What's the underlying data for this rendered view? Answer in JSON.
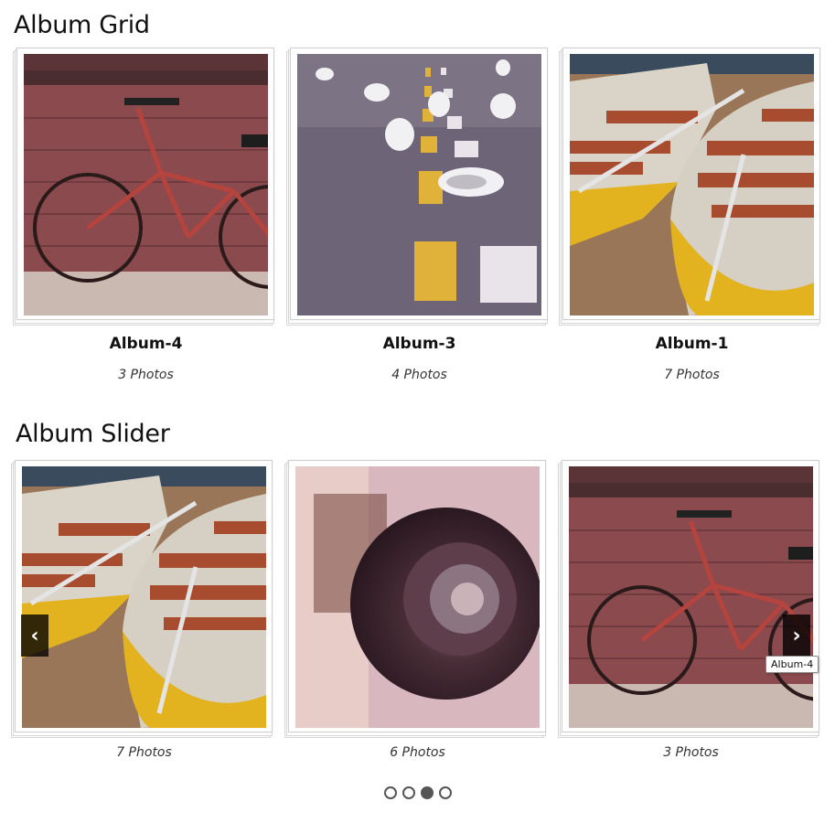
{
  "grid": {
    "title": "Album Grid",
    "albums": [
      {
        "title": "Album-4",
        "count": "3 Photos",
        "image": "bicycle-photo"
      },
      {
        "title": "Album-3",
        "count": "4 Photos",
        "image": "seagulls-photo"
      },
      {
        "title": "Album-1",
        "count": "7 Photos",
        "image": "rowboats-photo"
      }
    ]
  },
  "slider": {
    "title": "Album Slider",
    "slides": [
      {
        "count": "7 Photos",
        "image": "rowboats-photo"
      },
      {
        "count": "6 Photos",
        "image": "camera-lens-photo"
      },
      {
        "count": "3 Photos",
        "image": "bicycle-photo"
      }
    ],
    "prev_icon": "‹",
    "next_icon": "›",
    "tooltip": "Album-4",
    "dots": 4,
    "active_dot": 3
  },
  "colors": {
    "brick": "#8a4a4e",
    "road": "#6e6478",
    "boat_yellow": "#e2b21f",
    "lens_bg": "#d9b7bf"
  }
}
